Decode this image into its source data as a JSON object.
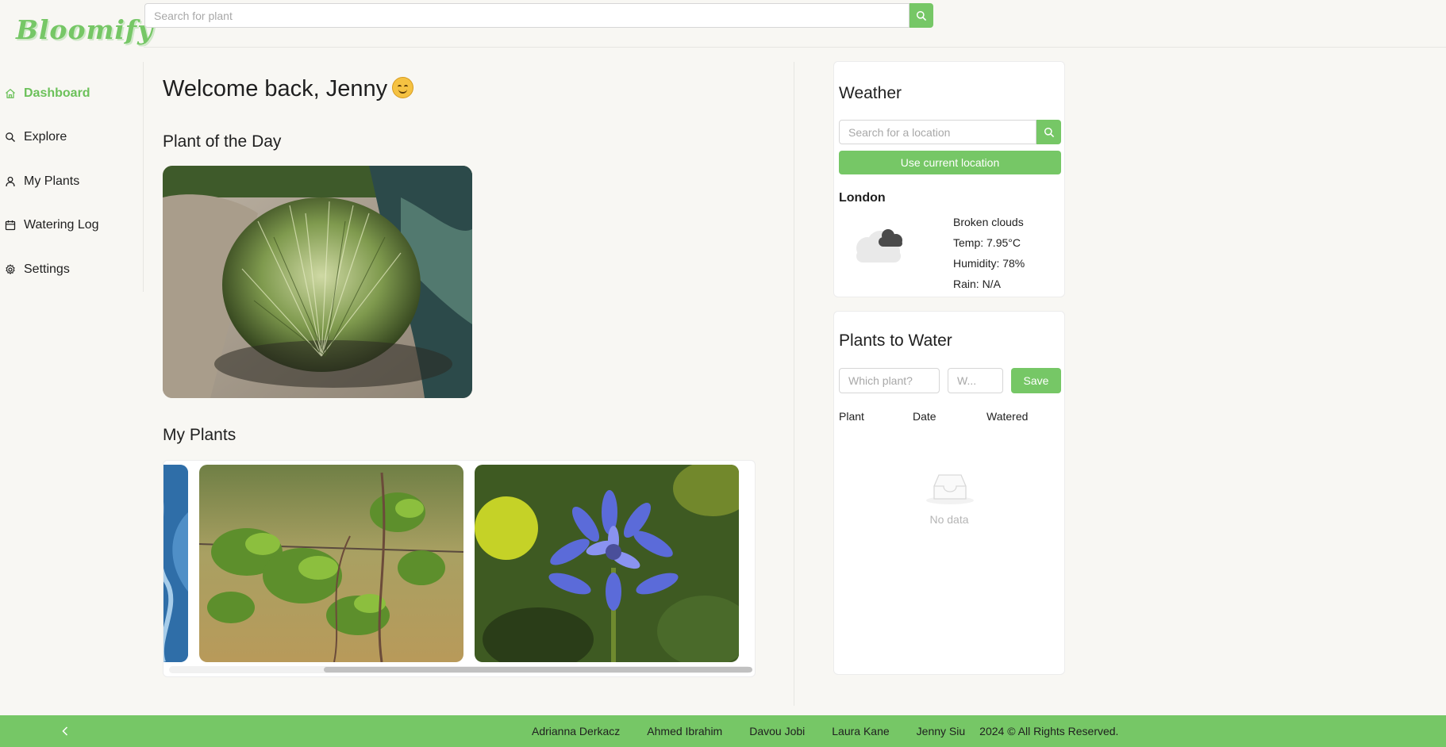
{
  "brand": {
    "name": "Bloomify",
    "accent": "#76c766"
  },
  "search": {
    "placeholder": "Search for plant",
    "icon": "search-icon"
  },
  "sidebar": {
    "items": [
      {
        "label": "Dashboard",
        "icon": "home-icon",
        "active": true
      },
      {
        "label": "Explore",
        "icon": "search-icon",
        "active": false
      },
      {
        "label": "My Plants",
        "icon": "user-icon",
        "active": false
      },
      {
        "label": "Watering Log",
        "icon": "calendar-icon",
        "active": false
      },
      {
        "label": "Settings",
        "icon": "gear-icon",
        "active": false
      }
    ]
  },
  "main": {
    "welcome": "Welcome back, Jenny",
    "plant_of_day_title": "Plant of the Day",
    "my_plants_title": "My Plants"
  },
  "weather": {
    "title": "Weather",
    "location_placeholder": "Search for a location",
    "use_current_label": "Use current location",
    "city": "London",
    "condition": "Broken clouds",
    "temp": "Temp: 7.95°C",
    "humidity": "Humidity: 78%",
    "rain": "Rain: N/A"
  },
  "water": {
    "title": "Plants to Water",
    "plant_placeholder": "Which plant?",
    "when_placeholder": "W...",
    "save_label": "Save",
    "columns": [
      "Plant",
      "Date",
      "Watered"
    ],
    "empty_text": "No data"
  },
  "footer": {
    "authors": [
      "Adrianna Derkacz",
      "Ahmed Ibrahim",
      "Davou Jobi",
      "Laura Kane",
      "Jenny Siu"
    ],
    "copyright": "2024 © All Rights Reserved."
  }
}
